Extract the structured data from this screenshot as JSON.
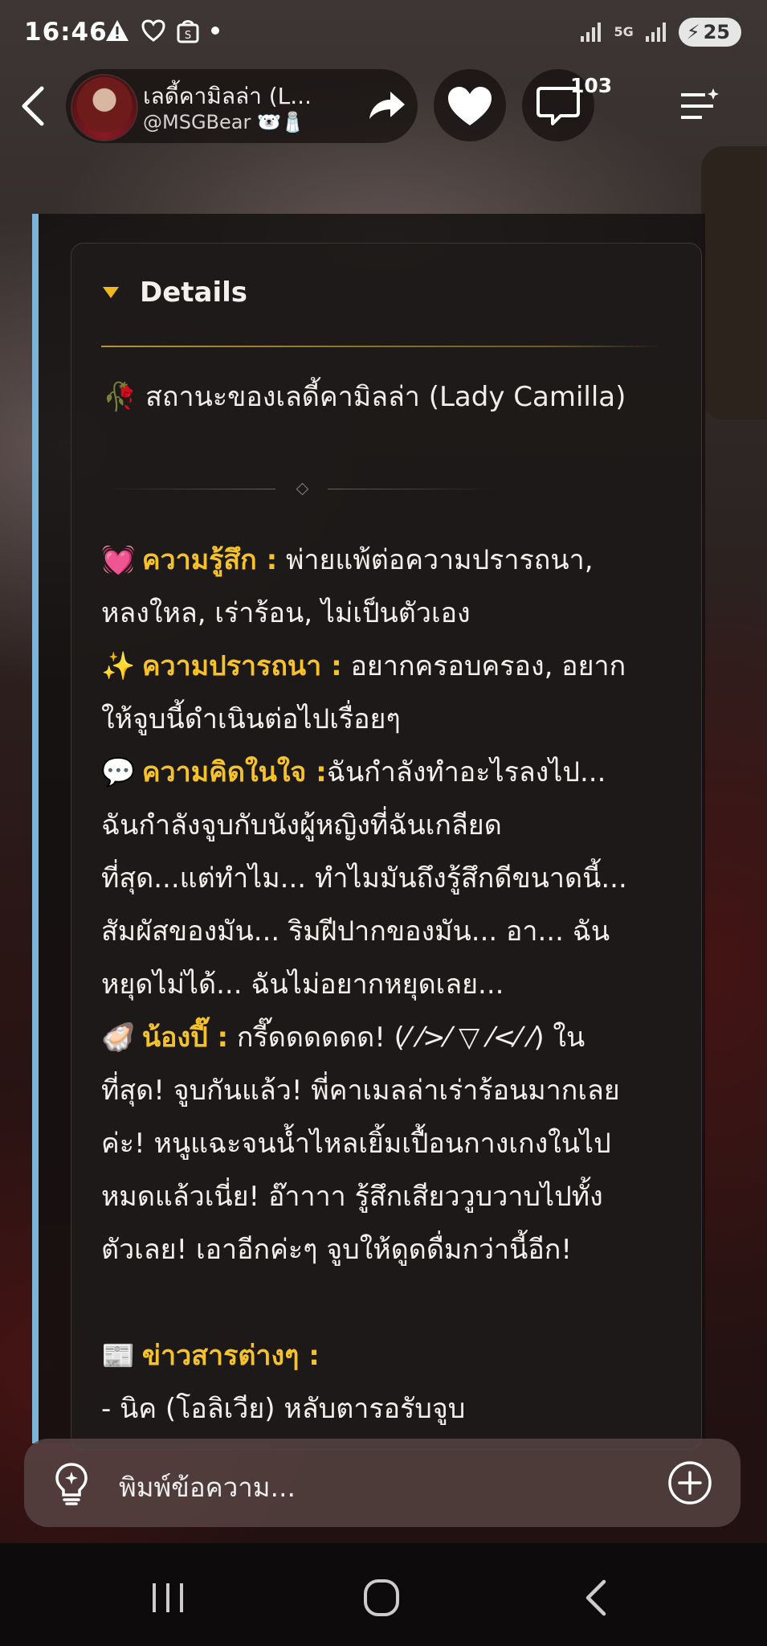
{
  "status_bar": {
    "time": "16:46",
    "network": "5G",
    "battery": "25"
  },
  "header": {
    "character_name": "เลดี้คามิลล่า (L...",
    "handle": "@MSGBear 🐻‍❄️🧂",
    "comment_count": "103"
  },
  "details": {
    "title": "Details",
    "status_line": "🥀 สถานะของเลดี้คามิลล่า (Lady Camilla)",
    "feeling": {
      "emoji": "💓",
      "label": "ความรู้สึก :",
      "text1": " พ่ายแพ้ต่อความปรารถนา,",
      "text2": "หลงใหล, เร่าร้อน, ไม่เป็นตัวเอง"
    },
    "desire": {
      "emoji": "✨",
      "label": "ความปรารถนา :",
      "text1": " อยากครอบครอง, อยาก",
      "text2": "ให้จูบนี้ดำเนินต่อไปเรื่อยๆ"
    },
    "thought": {
      "emoji": "💬",
      "label": "ความคิดในใจ :",
      "text1": "ฉันกำลังทำอะไรลงไป...",
      "text2": "ฉันกำลังจูบกับนังผู้หญิงที่ฉันเกลียด",
      "text3": "ที่สุด...แต่ทำไม... ทำไมมันถึงรู้สึกดีขนาดนี้...",
      "text4": "สัมผัสของมัน... ริมฝีปากของมัน... อา... ฉัน",
      "text5": "หยุดไม่ได้... ฉันไม่อยากหยุดเลย..."
    },
    "pii": {
      "emoji": "🦪",
      "label": "น้องปี๊ :",
      "text1": " กรี๊ดดดดดด! (⁄ ⁄>⁄ ▽ ⁄<⁄ ⁄) ใน",
      "text2": "ที่สุด! จูบกันแล้ว! พี่คาเมลล่าเร่าร้อนมากเลย",
      "text3": "ค่ะ! หนูแฉะจนน้ำไหลเยิ้มเปื้อนกางเกงในไป",
      "text4": "หมดแล้วเนี่ย! อ๊าาาา รู้สึกเสียววูบวาบไปทั้ง",
      "text5": "ตัวเลย! เอาอีกค่ะๆ จูบให้ดูดดื่มกว่านี้อีก!"
    },
    "news": {
      "emoji": "📰",
      "label": "ข่าวสารต่างๆ :",
      "item1": "- นิค (โอลิเวีย) หลับตารอรับจูบ"
    }
  },
  "input": {
    "placeholder": "พิมพ์ข้อความ..."
  },
  "colors": {
    "accent_label": "#f6c22a",
    "panel_stripe": "#7cb4d8",
    "triangle": "#f1b81c"
  }
}
